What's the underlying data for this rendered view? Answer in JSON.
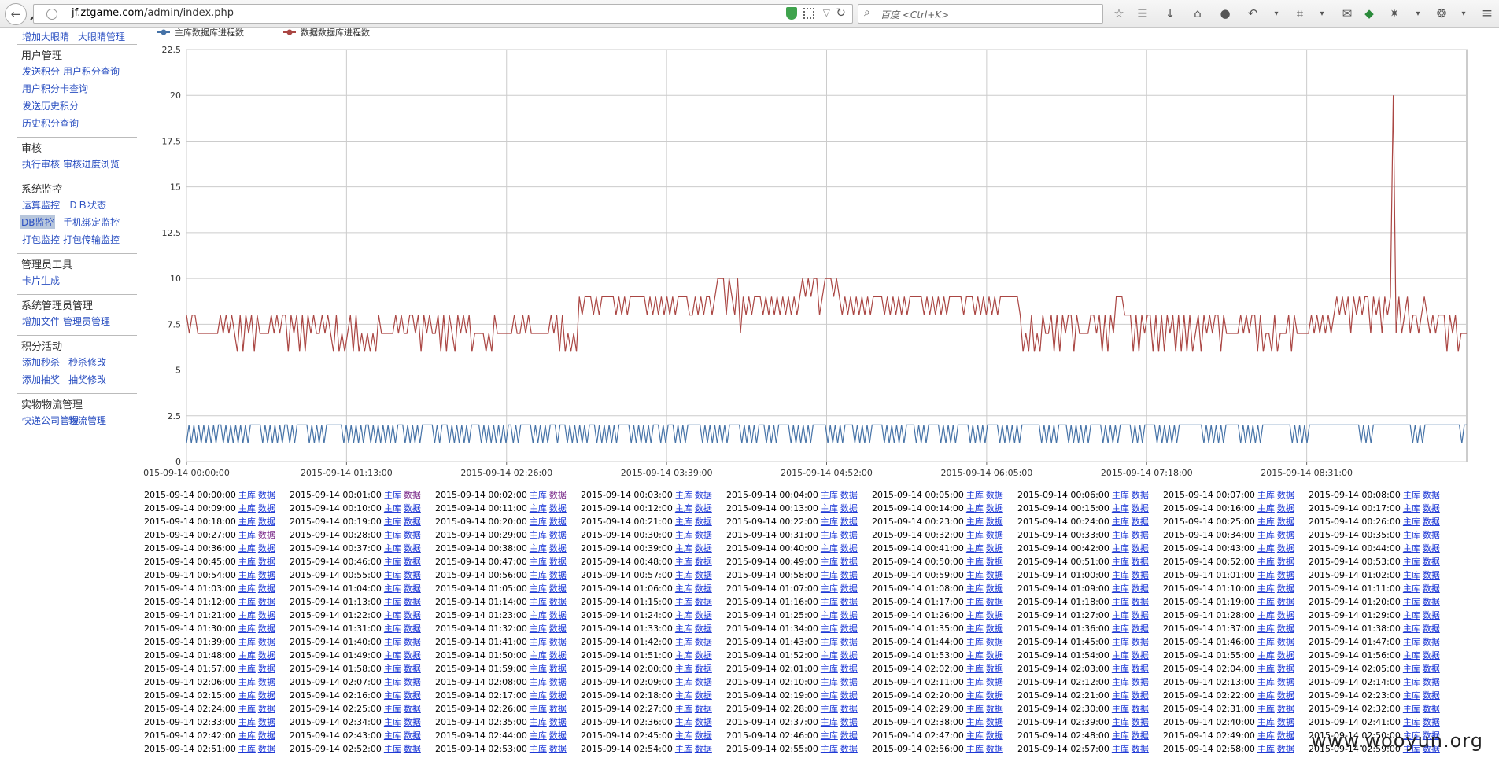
{
  "browser": {
    "url_host": "jf.ztgame.com",
    "url_path": "/admin/index.php",
    "search_placeholder": "百度 <Ctrl+K>"
  },
  "sidebar": {
    "top_links": [
      "增加大眼睛",
      "大眼睛管理"
    ],
    "sections": [
      {
        "title": "用户管理",
        "links": [
          [
            "发送积分",
            "用户积分查询"
          ],
          [
            "用户积分卡查询"
          ],
          [
            "发送历史积分"
          ],
          [
            "历史积分查询"
          ]
        ]
      },
      {
        "title": "审核",
        "links": [
          [
            "执行审核",
            "审核进度浏览"
          ]
        ]
      },
      {
        "title": "系统监控",
        "links": [
          [
            "运算监控",
            "ＤＢ状态"
          ],
          [
            "DB监控",
            "手机绑定监控"
          ],
          [
            "打包监控",
            "打包传输监控"
          ]
        ]
      },
      {
        "title": "管理员工具",
        "links": [
          [
            "卡片生成"
          ]
        ]
      },
      {
        "title": "系统管理员管理",
        "links": [
          [
            "增加文件",
            "管理员管理"
          ]
        ]
      },
      {
        "title": "积分活动",
        "links": [
          [
            "添加秒杀",
            "秒杀修改"
          ],
          [
            "添加抽奖",
            "抽奖修改"
          ]
        ]
      },
      {
        "title": "实物物流管理",
        "links": [
          [
            "快递公司管理",
            "物流管理"
          ]
        ]
      }
    ],
    "active_link": "DB监控"
  },
  "chart_data": {
    "type": "line",
    "ylim": [
      0,
      22.5
    ],
    "y_ticks": [
      "0",
      "2.5",
      "5",
      "7.5",
      "10",
      "12.5",
      "15",
      "17.5",
      "20",
      "22.5"
    ],
    "x_ticks": [
      "015-09-14 00:00:00",
      "2015-09-14 01:13:00",
      "2015-09-14 02:26:00",
      "2015-09-14 03:39:00",
      "2015-09-14 04:52:00",
      "2015-09-14 06:05:00",
      "2015-09-14 07:18:00",
      "2015-09-14 08:31:00"
    ],
    "x_range_minutes": [
      0,
      584
    ],
    "series": [
      {
        "name": "主库数据库进程数",
        "color": "#4572a7",
        "values": [
          1,
          2,
          1,
          2,
          1,
          2,
          1,
          2,
          1,
          2,
          1,
          2,
          1,
          2,
          2,
          1,
          2,
          1,
          2,
          1,
          2,
          1,
          2,
          1,
          2,
          1,
          2,
          2,
          2,
          2,
          2,
          1,
          2,
          1,
          2,
          1,
          2,
          1,
          2,
          1,
          2,
          2,
          1,
          2,
          1,
          2,
          2,
          2,
          2,
          2,
          1,
          2,
          1,
          2,
          1,
          2,
          1,
          2,
          2,
          2,
          2,
          2,
          2,
          2,
          1,
          2,
          1,
          2,
          1,
          2,
          1,
          2,
          1,
          2,
          2,
          1,
          2,
          1,
          2,
          1,
          2,
          1,
          2,
          1,
          2,
          1,
          2,
          2,
          2,
          1,
          2,
          1,
          2,
          1,
          2,
          1,
          2,
          2,
          2,
          2,
          2,
          1,
          2,
          1,
          2,
          2,
          2,
          1,
          2,
          1,
          2,
          1,
          2,
          1,
          2,
          1,
          2,
          2,
          2,
          2,
          1,
          2,
          1,
          2,
          1,
          2,
          1,
          2,
          1,
          2,
          1,
          2,
          2,
          1,
          2,
          1,
          2,
          2,
          2,
          2,
          2,
          1,
          2,
          1,
          2,
          1,
          2,
          1,
          2,
          2,
          2,
          1,
          2,
          2,
          2,
          1,
          2,
          1,
          2,
          1,
          2,
          1,
          2,
          1,
          2,
          2,
          2,
          1,
          2,
          1,
          2,
          1,
          2,
          1,
          2,
          1,
          2,
          2,
          2,
          2,
          2,
          1,
          2,
          1,
          2,
          1,
          2,
          1,
          2,
          1,
          2,
          2,
          2,
          1,
          2,
          1,
          2,
          2,
          2,
          1,
          2,
          1,
          2,
          1,
          2,
          2,
          2,
          2,
          2,
          2,
          1,
          2,
          1,
          2,
          1,
          2,
          1,
          2,
          1,
          2,
          1,
          2,
          2,
          2,
          2,
          2,
          1,
          2,
          1,
          2,
          1,
          2,
          1,
          2,
          2,
          2,
          1,
          2,
          1,
          2,
          1,
          2,
          2,
          2,
          2,
          2,
          1,
          2,
          1,
          2,
          1,
          2,
          1,
          2,
          1,
          2,
          2,
          2,
          2,
          2,
          2,
          1,
          2,
          1,
          2,
          1,
          2,
          1,
          2,
          2,
          2,
          2,
          1,
          2,
          1,
          2,
          1,
          2,
          1,
          2,
          2,
          2,
          2,
          2,
          1,
          2,
          1,
          2,
          1,
          2,
          1,
          2,
          1,
          2,
          2,
          2,
          2,
          1,
          2,
          1,
          2,
          1,
          2,
          2,
          2,
          2,
          2,
          1,
          2,
          1,
          2,
          1,
          2,
          1,
          2,
          2,
          2,
          2,
          2,
          1,
          2,
          1,
          2,
          1,
          2,
          1,
          2,
          2,
          2,
          2,
          2,
          1,
          2,
          1,
          2,
          1,
          2,
          1,
          2,
          1,
          2,
          2,
          2,
          2,
          2,
          2,
          2,
          2,
          1,
          2,
          1,
          2,
          1,
          2,
          1,
          2,
          2,
          2,
          2,
          1,
          2,
          1,
          2,
          1,
          2,
          1,
          2,
          1,
          2,
          2,
          2,
          2,
          2,
          1,
          2,
          1,
          2,
          1,
          2,
          1,
          2,
          2,
          2,
          2,
          2,
          1,
          2,
          1,
          2,
          1,
          2,
          2,
          2,
          2,
          2,
          1,
          2,
          1,
          2,
          1,
          2,
          1,
          2,
          1,
          2,
          2,
          2,
          2,
          2,
          2,
          2,
          2,
          2,
          2,
          1,
          2,
          1,
          2,
          1,
          2,
          1,
          2,
          1,
          2,
          2,
          2,
          2,
          2,
          2,
          1,
          2,
          1,
          2,
          1,
          2,
          1,
          2,
          1,
          2,
          2,
          2,
          2,
          2,
          2,
          2,
          2,
          2,
          2,
          2,
          2,
          1,
          2,
          1,
          2,
          1,
          2,
          1,
          2,
          2,
          2,
          2,
          2,
          2,
          2,
          2,
          2,
          2,
          2,
          2,
          2,
          2,
          2,
          2,
          2,
          2,
          2,
          2,
          2,
          1,
          2,
          1,
          2,
          1,
          2,
          2,
          2,
          2,
          2,
          2,
          2,
          2,
          2,
          2,
          2,
          2,
          2,
          2,
          2,
          2,
          1,
          2,
          1,
          2,
          1,
          2,
          2,
          2,
          2,
          2,
          2,
          2,
          2,
          2,
          2,
          2,
          2,
          2,
          2,
          2,
          1,
          2,
          2
        ]
      },
      {
        "name": "数据数据库进程数",
        "color": "#aa4643",
        "values": [
          8,
          7,
          8,
          8,
          7,
          7,
          7,
          7,
          7,
          7,
          7,
          7,
          8,
          7,
          8,
          7,
          8,
          7,
          6,
          8,
          6,
          8,
          7,
          8,
          6,
          8,
          7,
          7,
          7,
          7,
          8,
          7,
          8,
          7,
          8,
          8,
          6,
          8,
          7,
          8,
          6,
          8,
          6,
          8,
          7,
          8,
          7,
          7,
          8,
          7,
          8,
          7,
          6,
          8,
          6,
          7,
          6,
          7,
          8,
          6,
          8,
          6,
          7,
          6,
          7,
          6,
          7,
          6,
          8,
          7,
          7,
          7,
          7,
          7,
          8,
          7,
          8,
          7,
          7,
          8,
          8,
          7,
          8,
          6,
          8,
          7,
          8,
          7,
          7,
          8,
          6,
          8,
          6,
          8,
          7,
          6,
          8,
          7,
          8,
          7,
          8,
          6,
          7,
          7,
          7,
          7,
          6,
          7,
          6,
          8,
          7,
          7,
          7,
          7,
          7,
          7,
          8,
          7,
          7,
          8,
          7,
          8,
          7,
          7,
          7,
          7,
          7,
          7,
          7,
          8,
          7,
          8,
          6,
          8,
          6,
          7,
          6,
          7,
          6,
          9,
          8,
          9,
          9,
          9,
          8,
          9,
          8,
          9,
          9,
          9,
          9,
          9,
          8,
          9,
          8,
          9,
          8,
          9,
          9,
          9,
          9,
          9,
          9,
          8,
          9,
          8,
          9,
          8,
          9,
          8,
          9,
          8,
          9,
          8,
          9,
          9,
          9,
          9,
          8,
          8,
          9,
          8,
          9,
          8,
          9,
          9,
          8,
          9,
          10,
          10,
          10,
          8,
          10,
          9,
          8,
          10,
          7,
          9,
          8,
          9,
          8,
          9,
          9,
          9,
          8,
          9,
          8,
          9,
          8,
          9,
          8,
          9,
          8,
          9,
          8,
          9,
          8,
          9,
          10,
          9,
          10,
          9,
          10,
          10,
          8,
          9,
          10,
          10,
          10,
          9,
          10,
          9,
          8,
          9,
          8,
          9,
          8,
          9,
          8,
          9,
          8,
          9,
          8,
          9,
          9,
          9,
          9,
          8,
          9,
          8,
          9,
          8,
          9,
          8,
          9,
          8,
          9,
          9,
          9,
          9,
          9,
          8,
          9,
          8,
          9,
          8,
          9,
          8,
          9,
          8,
          9,
          9,
          9,
          9,
          9,
          8,
          9,
          9,
          9,
          8,
          9,
          8,
          9,
          8,
          9,
          8,
          9,
          8,
          9,
          9,
          9,
          9,
          9,
          9,
          9,
          8,
          6,
          7,
          6,
          8,
          6,
          7,
          6,
          8,
          7,
          7,
          8,
          6,
          8,
          6,
          8,
          7,
          8,
          8,
          6,
          8,
          7,
          7,
          7,
          7,
          8,
          8,
          7,
          8,
          6,
          8,
          6,
          8,
          7,
          9,
          9,
          9,
          8,
          8,
          8,
          6,
          8,
          6,
          8,
          7,
          8,
          8,
          6,
          8,
          6,
          8,
          6,
          8,
          7,
          8,
          6,
          8,
          6,
          8,
          6,
          8,
          6,
          7,
          8,
          6,
          8,
          7,
          8,
          7,
          8,
          8,
          6,
          8,
          7,
          7,
          7,
          7,
          7,
          8,
          7,
          8,
          7,
          8,
          8,
          6,
          8,
          6,
          7,
          7,
          6,
          8,
          6,
          7,
          7,
          7,
          8,
          6,
          8,
          7,
          7,
          7,
          7,
          7,
          8,
          7,
          8,
          7,
          8,
          7,
          8,
          7,
          8,
          9,
          8,
          9,
          8,
          9,
          7,
          9,
          8,
          9,
          8,
          9,
          9,
          7,
          9,
          8,
          9,
          7,
          9,
          8,
          9,
          20,
          7,
          9,
          7,
          8,
          9,
          7,
          8,
          8,
          7,
          8,
          9,
          8,
          7,
          8,
          7,
          8,
          8,
          8,
          6,
          8,
          7,
          8,
          6,
          7,
          7,
          7
        ]
      }
    ]
  },
  "links": {
    "primary": "主库",
    "data": "数据",
    "start_minute": 0,
    "end_minute": 179,
    "columns": 9,
    "date_prefix": "2015-09-14",
    "visited_data_minutes": [
      1,
      2,
      27
    ]
  },
  "watermark": "www.wooyun.org"
}
